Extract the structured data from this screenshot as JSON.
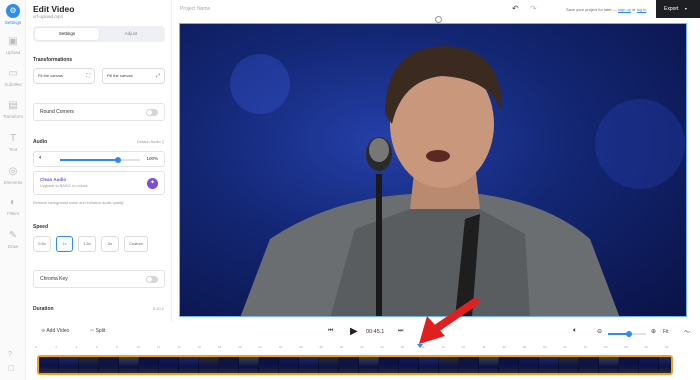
{
  "rail": {
    "items": [
      {
        "label": "Settings",
        "icon": "gear-icon",
        "glyph": "⚙",
        "active": true
      },
      {
        "label": "Upload",
        "icon": "upload-icon",
        "glyph": "▣"
      },
      {
        "label": "Subtitles",
        "icon": "subtitles-icon",
        "glyph": "▭"
      },
      {
        "label": "Transform",
        "icon": "transform-icon",
        "glyph": "▤"
      },
      {
        "label": "Text",
        "icon": "text-icon",
        "glyph": "T"
      },
      {
        "label": "Elements",
        "icon": "elements-icon",
        "glyph": "◎"
      },
      {
        "label": "Filters",
        "icon": "filters-icon",
        "glyph": "◐"
      },
      {
        "label": "Draw",
        "icon": "draw-icon",
        "glyph": "✎"
      }
    ],
    "help_glyph": "?",
    "chat_glyph": "▢"
  },
  "panel": {
    "title": "Edit Video",
    "filename": "vrf-upload.mp4",
    "tabs": {
      "settings": "Settings",
      "adjust": "Adjust"
    },
    "transformations": {
      "heading": "Transformations",
      "fit_label": "Fit the canvas",
      "fill_label": "Fill the canvas"
    },
    "round_corners": "Round Corners",
    "audio": {
      "heading": "Audio",
      "detach": "Detach Audio",
      "volume_pct": 72,
      "volume_label": "100%",
      "clean_title": "Clean Audio",
      "clean_sub": "Upgrade to BASIC to unlock",
      "remove_note": "Remove background noise and enhance audio quality"
    },
    "speed": {
      "heading": "Speed",
      "options": [
        "0.5x",
        "1x",
        "1.5x",
        "2x",
        "Custom"
      ],
      "selected": 1
    },
    "chroma_key": "Chroma Key",
    "duration": {
      "heading": "Duration",
      "value": "0:10.2"
    }
  },
  "topbar": {
    "project_name": "Project Name",
    "undo_glyph": "↶",
    "redo_glyph": "↷",
    "save_prefix": "Save your project for later —",
    "sign_up": "sign up",
    "or": "or",
    "log_in": "log in",
    "export": "Export"
  },
  "controls": {
    "add_video": "Add Video",
    "split": "Split",
    "time": "00:45.1",
    "fit": "Fit",
    "zoom_pct": 55
  },
  "ruler": {
    "ticks": [
      "0",
      "2",
      "4",
      "6",
      "8",
      "10",
      "12",
      "14",
      "16",
      "18",
      "20",
      "22",
      "24",
      "26",
      "28",
      "30",
      "32",
      "34",
      "36",
      "38",
      "40",
      "42",
      "44",
      "46",
      "48",
      "50",
      "52",
      "54",
      "56",
      "58",
      "60",
      "62"
    ]
  },
  "colors": {
    "accent": "#2d8cf0",
    "timeline_border": "#f0a020",
    "arrow": "#e02020",
    "clean_purple": "#7b4dd6"
  }
}
